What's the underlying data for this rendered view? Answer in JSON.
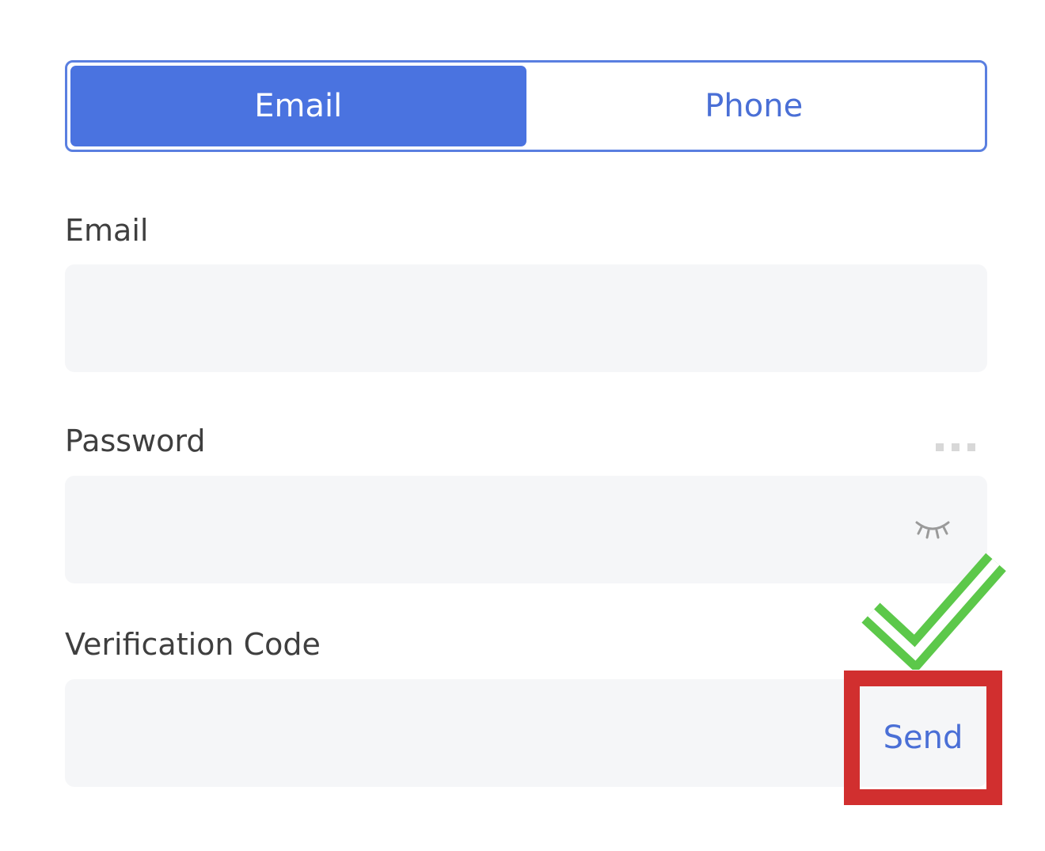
{
  "tabs": [
    {
      "label": "Email",
      "active": true
    },
    {
      "label": "Phone",
      "active": false
    }
  ],
  "form": {
    "email": {
      "label": "Email",
      "value": "",
      "placeholder": ""
    },
    "password": {
      "label": "Password",
      "value": "",
      "placeholder": "",
      "toggle_icon": "eye-closed-icon",
      "options_icon": "more-dots-icon"
    },
    "verification": {
      "label": "Verification Code",
      "value": "",
      "placeholder": "",
      "send_label": "Send"
    }
  },
  "annotations": {
    "checkmark_icon": "checkmark-icon",
    "checkmark_color": "#5cc84a",
    "highlight_box_color": "#d12f2f"
  },
  "colors": {
    "accent": "#4a73e0",
    "link": "#4a6fd6",
    "field_bg": "#f5f6f8"
  }
}
